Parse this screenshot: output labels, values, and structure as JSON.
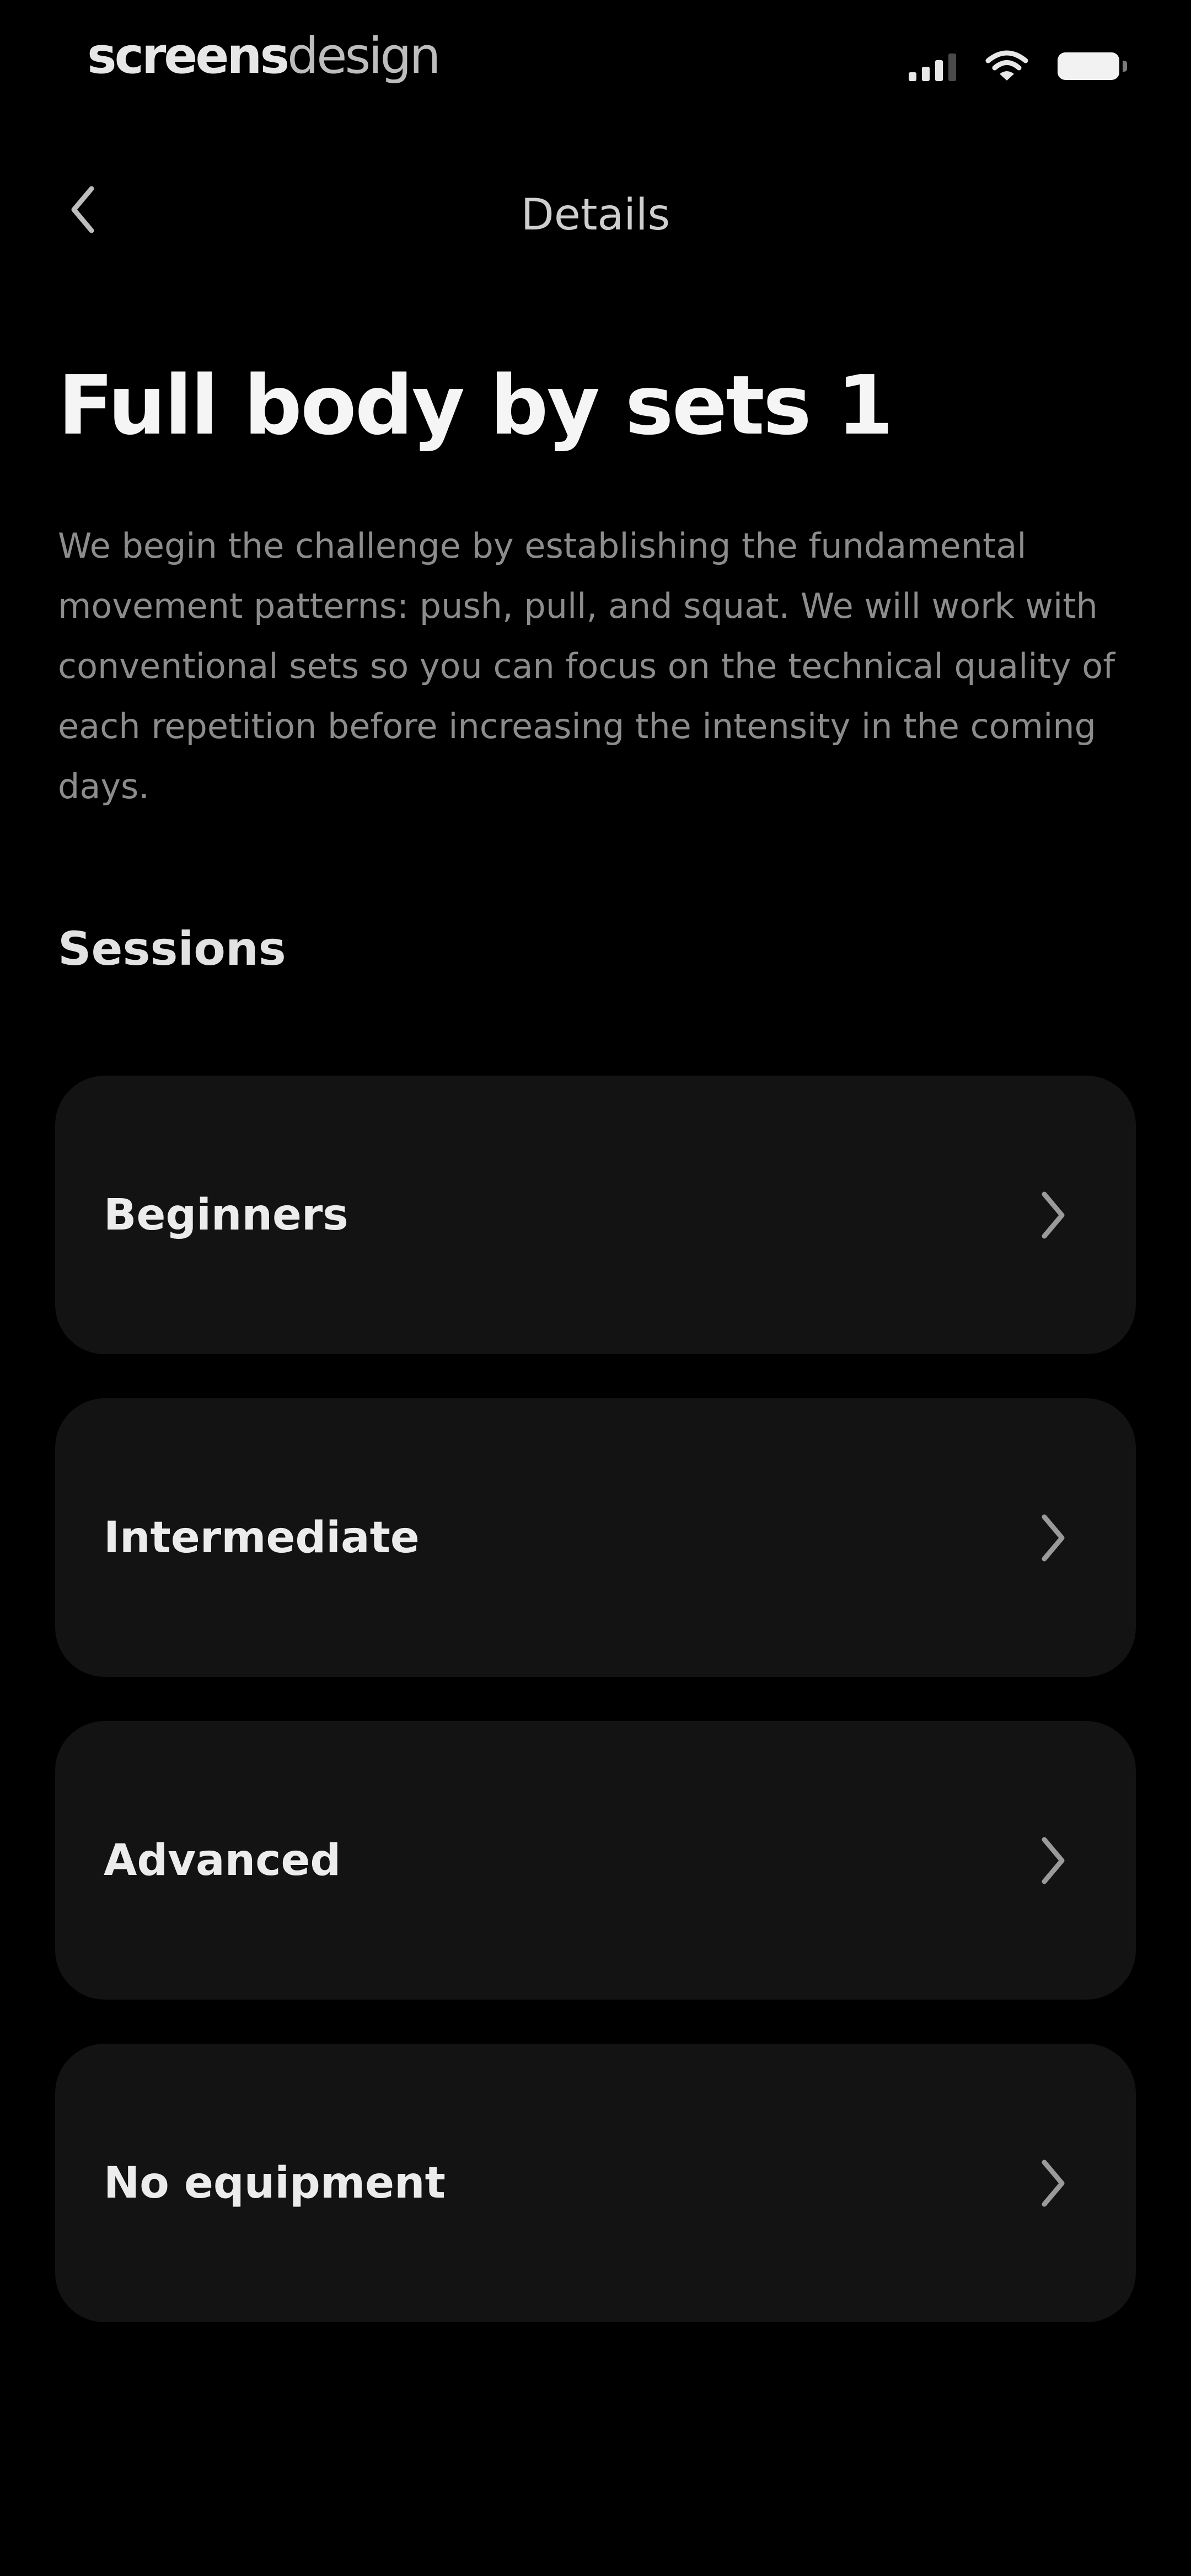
{
  "status_bar": {
    "brand_bold": "screens",
    "brand_light": "design",
    "icons": [
      "signal-icon",
      "wifi-icon",
      "battery-icon"
    ]
  },
  "nav": {
    "back_icon": "chevron-left-icon",
    "title": "Details"
  },
  "workout": {
    "title": "Full body by sets 1",
    "description": "We begin the challenge by establishing the fundamental movement patterns: push, pull, and squat. We will work with conventional sets so you can focus on the technical quality of each repetition before increasing the intensity in the coming days."
  },
  "sessions": {
    "heading": "Sessions",
    "items": [
      {
        "label": "Beginners",
        "icon": "chevron-right-icon"
      },
      {
        "label": "Intermediate",
        "icon": "chevron-right-icon"
      },
      {
        "label": "Advanced",
        "icon": "chevron-right-icon"
      },
      {
        "label": "No equipment",
        "icon": "chevron-right-icon"
      }
    ]
  },
  "colors": {
    "background": "#000000",
    "card": "#131313",
    "text_primary": "#f5f5f5",
    "text_secondary": "#8c8c8c"
  }
}
